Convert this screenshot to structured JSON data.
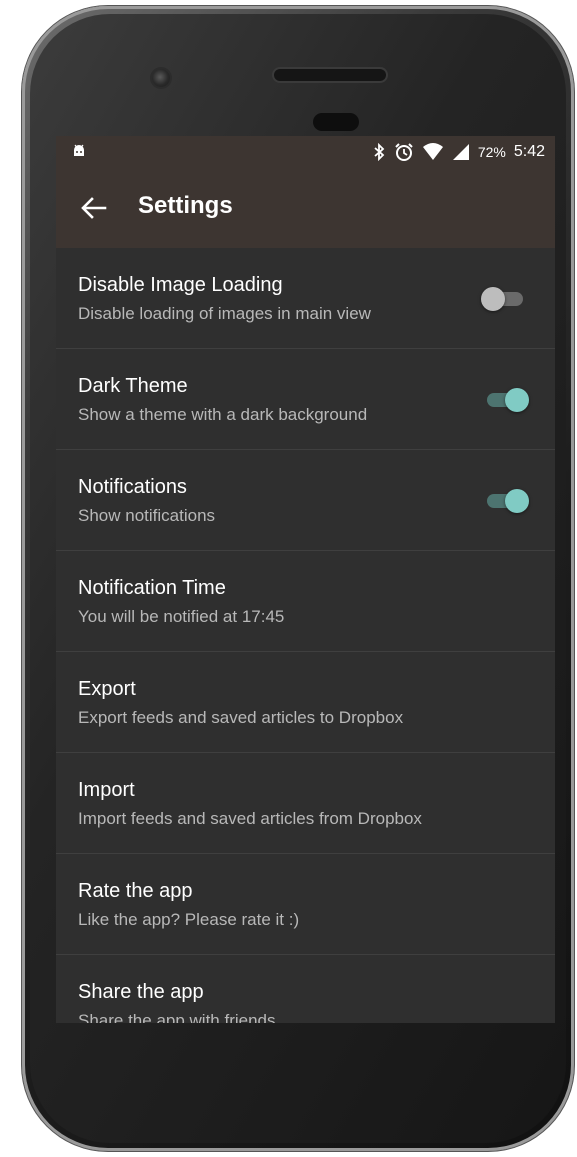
{
  "status_bar": {
    "battery": "72%",
    "time": "5:42",
    "icons": [
      "android-icon",
      "bluetooth-icon",
      "alarm-icon",
      "wifi-icon",
      "signal-icon"
    ]
  },
  "app_bar": {
    "title": "Settings",
    "back_icon": "arrow-left-icon"
  },
  "settings": [
    {
      "title": "Disable Image Loading",
      "subtitle": "Disable loading of images in main view",
      "toggle": "off"
    },
    {
      "title": "Dark Theme",
      "subtitle": "Show a theme with a dark background",
      "toggle": "on"
    },
    {
      "title": "Notifications",
      "subtitle": "Show notifications",
      "toggle": "on"
    },
    {
      "title": "Notification Time",
      "subtitle": "You will be notified at 17:45"
    },
    {
      "title": "Export",
      "subtitle": "Export feeds and saved articles to Dropbox"
    },
    {
      "title": "Import",
      "subtitle": "Import feeds and saved articles from Dropbox"
    },
    {
      "title": "Rate the app",
      "subtitle": "Like the app? Please rate it :)"
    },
    {
      "title": "Share the app",
      "subtitle": "Share the app with friends"
    }
  ],
  "colors": {
    "appbar": "#3d3531",
    "background": "#2f2f2f",
    "accent": "#80cbc4"
  }
}
